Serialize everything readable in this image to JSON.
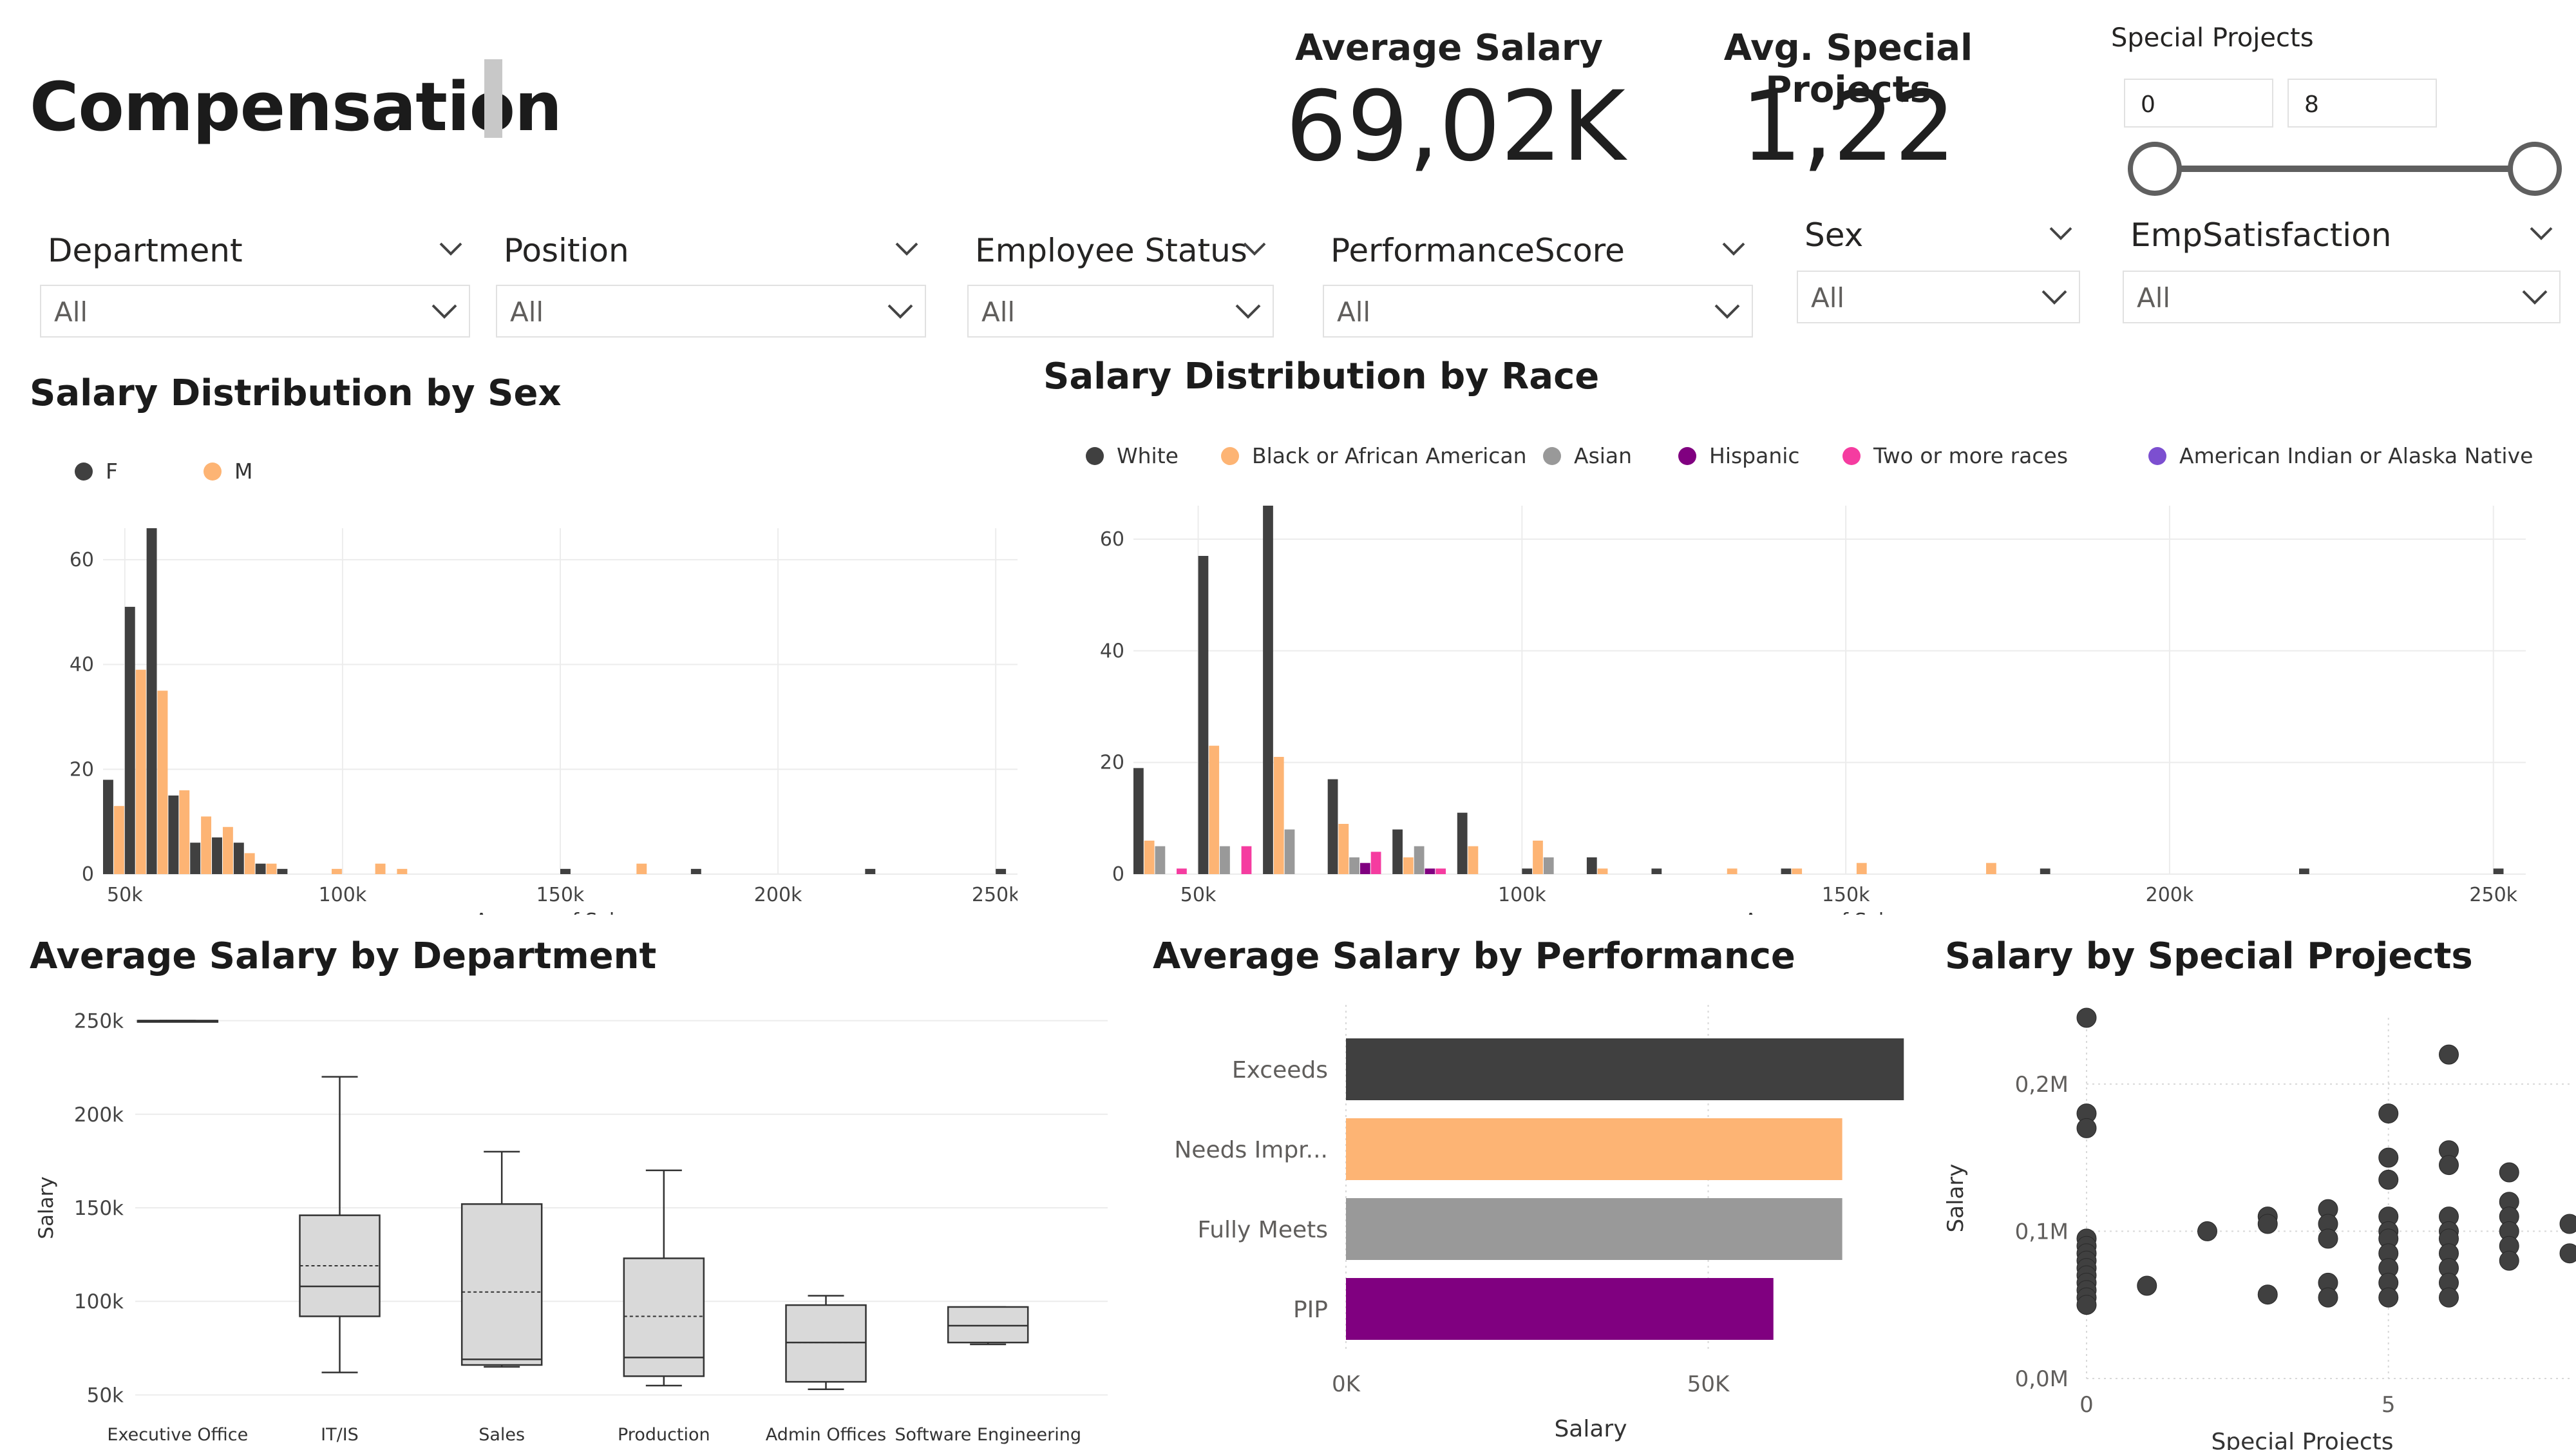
{
  "page": {
    "title": "Compensation"
  },
  "kpis": [
    {
      "label": "Average Salary",
      "value": "69,02K"
    },
    {
      "label": "Avg. Special Projects",
      "value": "1,22"
    }
  ],
  "special_projects_slicer": {
    "label": "Special Projects",
    "min": "0",
    "max": "8",
    "range_fraction": [
      0,
      1
    ]
  },
  "slicers": [
    {
      "title": "Department",
      "value": "All"
    },
    {
      "title": "Position",
      "value": "All"
    },
    {
      "title": "Employee Status",
      "value": "All"
    },
    {
      "title": "PerformanceScore",
      "value": "All"
    },
    {
      "title": "Sex",
      "value": "All"
    },
    {
      "title": "EmpSatisfaction",
      "value": "All"
    }
  ],
  "colors": {
    "white_f": "#404040",
    "black_m": "#FDB474",
    "asian": "#999999",
    "hispanic": "#800080",
    "two_or_more": "#F53CA0",
    "amer_indian": "#7C4FD0",
    "box_fill": "#d9d9d9",
    "grid": "#ececec"
  },
  "visuals": {
    "sex_hist": {
      "title": "Salary Distribution by Sex",
      "xlabel": "Average of Salary"
    },
    "race_hist": {
      "title": "Salary Distribution by Race",
      "xlabel": "Average of Salary"
    },
    "dept_box": {
      "title": "Average Salary by Department",
      "ylabel": "Salary"
    },
    "perf_bar": {
      "title": "Average Salary by Performance",
      "xlabel": "Salary"
    },
    "sp_scatter": {
      "title": "Salary by Special Projects",
      "xlabel": "Special Projects",
      "ylabel": "Salary"
    }
  },
  "chart_data": [
    {
      "type": "bar",
      "title": "Salary Distribution by Sex",
      "xlabel": "Average of Salary",
      "ylabel": "",
      "xlim": [
        45000,
        255000
      ],
      "ylim": [
        0,
        66
      ],
      "bin_width": 5000,
      "x_ticks": [
        50000,
        100000,
        150000,
        200000,
        250000
      ],
      "x_tick_labels": [
        "50k",
        "100k",
        "150k",
        "200k",
        "250k"
      ],
      "y_ticks": [
        0,
        20,
        40,
        60
      ],
      "legend": "top-left",
      "grid": true,
      "bin_starts": [
        45000,
        50000,
        55000,
        60000,
        65000,
        70000,
        75000,
        80000,
        85000,
        90000,
        95000,
        100000,
        105000,
        110000,
        115000,
        120000,
        125000,
        130000,
        135000,
        140000,
        145000,
        150000,
        155000,
        160000,
        165000,
        170000,
        175000,
        180000,
        185000,
        190000,
        195000,
        200000,
        205000,
        210000,
        215000,
        220000,
        225000,
        230000,
        235000,
        240000,
        245000,
        250000
      ],
      "series": [
        {
          "name": "F",
          "color": "#404040",
          "values": [
            18,
            51,
            66,
            15,
            6,
            7,
            6,
            2,
            1,
            0,
            0,
            0,
            0,
            0,
            0,
            0,
            0,
            0,
            0,
            0,
            0,
            1,
            0,
            0,
            0,
            0,
            0,
            1,
            0,
            0,
            0,
            0,
            0,
            0,
            0,
            1,
            0,
            0,
            0,
            0,
            0,
            1
          ]
        },
        {
          "name": "M",
          "color": "#FDB474",
          "values": [
            13,
            39,
            35,
            16,
            11,
            9,
            4,
            2,
            0,
            0,
            1,
            0,
            2,
            1,
            0,
            0,
            0,
            0,
            0,
            0,
            0,
            0,
            0,
            0,
            2,
            0,
            0,
            0,
            0,
            0,
            0,
            0,
            0,
            0,
            0,
            0,
            0,
            0,
            0,
            0,
            0,
            0
          ]
        }
      ]
    },
    {
      "type": "bar",
      "title": "Salary Distribution by Race",
      "xlabel": "Average of Salary",
      "ylabel": "",
      "xlim": [
        40000,
        255000
      ],
      "ylim": [
        0,
        66
      ],
      "bin_width": 10000,
      "x_ticks": [
        50000,
        100000,
        150000,
        200000,
        250000
      ],
      "x_tick_labels": [
        "50k",
        "100k",
        "150k",
        "200k",
        "250k"
      ],
      "y_ticks": [
        0,
        20,
        40,
        60
      ],
      "legend": "top",
      "grid": true,
      "bin_starts": [
        40000,
        50000,
        60000,
        70000,
        80000,
        90000,
        100000,
        110000,
        120000,
        130000,
        140000,
        150000,
        160000,
        170000,
        180000,
        190000,
        200000,
        210000,
        220000,
        230000,
        240000,
        250000
      ],
      "series": [
        {
          "name": "White",
          "color": "#404040",
          "values": [
            19,
            57,
            66,
            17,
            8,
            11,
            1,
            3,
            1,
            0,
            1,
            0,
            0,
            0,
            1,
            0,
            0,
            0,
            1,
            0,
            0,
            1
          ]
        },
        {
          "name": "Black or African American",
          "color": "#FDB474",
          "values": [
            6,
            23,
            21,
            9,
            3,
            5,
            6,
            1,
            0,
            1,
            1,
            2,
            0,
            2,
            0,
            0,
            0,
            0,
            0,
            0,
            0,
            0
          ]
        },
        {
          "name": "Asian",
          "color": "#999999",
          "values": [
            5,
            5,
            8,
            3,
            5,
            0,
            3,
            0,
            0,
            0,
            0,
            0,
            0,
            0,
            0,
            0,
            0,
            0,
            0,
            0,
            0,
            0
          ]
        },
        {
          "name": "Hispanic",
          "color": "#800080",
          "values": [
            0,
            0,
            0,
            2,
            1,
            0,
            0,
            0,
            0,
            0,
            0,
            0,
            0,
            0,
            0,
            0,
            0,
            0,
            0,
            0,
            0,
            0
          ]
        },
        {
          "name": "Two or more races",
          "color": "#F53CA0",
          "values": [
            1,
            5,
            0,
            4,
            1,
            0,
            0,
            0,
            0,
            0,
            0,
            0,
            0,
            0,
            0,
            0,
            0,
            0,
            0,
            0,
            0,
            0
          ]
        },
        {
          "name": "American Indian or Alaska Native",
          "color": "#7C4FD0",
          "values": [
            0,
            0,
            0,
            0,
            0,
            0,
            0,
            0,
            0,
            0,
            0,
            0,
            0,
            0,
            0,
            0,
            0,
            0,
            0,
            0,
            0,
            0
          ]
        }
      ]
    },
    {
      "type": "box",
      "title": "Average Salary by Department",
      "ylabel": "Salary",
      "ylim": [
        45000,
        255000
      ],
      "y_ticks": [
        50000,
        100000,
        150000,
        200000,
        250000
      ],
      "y_tick_labels": [
        "50k",
        "100k",
        "150k",
        "200k",
        "250k"
      ],
      "grid": true,
      "categories": [
        "Executive Office",
        "IT/IS",
        "Sales",
        "Production",
        "Admin Offices",
        "Software Engineering"
      ],
      "boxes": [
        {
          "min": 250000,
          "q1": 250000,
          "median": 250000,
          "mean": 250000,
          "q3": 250000,
          "max": 250000
        },
        {
          "min": 62000,
          "q1": 92000,
          "median": 108000,
          "mean": 119000,
          "q3": 146000,
          "max": 220000
        },
        {
          "min": 65000,
          "q1": 66000,
          "median": 69000,
          "mean": 105000,
          "q3": 152000,
          "max": 180000
        },
        {
          "min": 55000,
          "q1": 60000,
          "median": 70000,
          "mean": 92000,
          "q3": 123000,
          "max": 170000
        },
        {
          "min": 53000,
          "q1": 57000,
          "median": 78000,
          "mean": 78000,
          "q3": 98000,
          "max": 103000
        },
        {
          "min": 77000,
          "q1": 78000,
          "median": 87000,
          "mean": 87000,
          "q3": 97000,
          "max": 97000
        }
      ]
    },
    {
      "type": "bar",
      "orientation": "horizontal",
      "title": "Average Salary by Performance",
      "xlabel": "Salary",
      "xlim": [
        0,
        80000
      ],
      "x_ticks": [
        0,
        50000
      ],
      "x_tick_labels": [
        "0K",
        "50K"
      ],
      "grid": true,
      "categories": [
        "Exceeds",
        "Needs Impr...",
        "Fully Meets",
        "PIP"
      ],
      "values": [
        77000,
        68500,
        68500,
        59000
      ],
      "colors": [
        "#404040",
        "#FDB474",
        "#999999",
        "#800080"
      ]
    },
    {
      "type": "scatter",
      "title": "Salary by Special Projects",
      "xlabel": "Special Projects",
      "ylabel": "Salary",
      "xlim": [
        0,
        8
      ],
      "ylim": [
        0,
        245000
      ],
      "x_ticks": [
        0,
        5
      ],
      "y_ticks": [
        0,
        100000,
        200000
      ],
      "y_tick_labels": [
        "0,0M",
        "0,1M",
        "0,2M"
      ],
      "grid": true,
      "color": "#404040",
      "points": [
        [
          0,
          245000
        ],
        [
          0,
          180000
        ],
        [
          0,
          170000
        ],
        [
          0,
          95000
        ],
        [
          0,
          90000
        ],
        [
          0,
          85000
        ],
        [
          0,
          80000
        ],
        [
          0,
          75000
        ],
        [
          0,
          70000
        ],
        [
          0,
          65000
        ],
        [
          0,
          60000
        ],
        [
          0,
          55000
        ],
        [
          0,
          50000
        ],
        [
          1,
          63000
        ],
        [
          2,
          100000
        ],
        [
          3,
          110000
        ],
        [
          3,
          105000
        ],
        [
          3,
          57000
        ],
        [
          4,
          115000
        ],
        [
          4,
          105000
        ],
        [
          4,
          95000
        ],
        [
          4,
          65000
        ],
        [
          4,
          55000
        ],
        [
          5,
          180000
        ],
        [
          5,
          150000
        ],
        [
          5,
          135000
        ],
        [
          5,
          110000
        ],
        [
          5,
          100000
        ],
        [
          5,
          95000
        ],
        [
          5,
          85000
        ],
        [
          5,
          75000
        ],
        [
          5,
          65000
        ],
        [
          5,
          55000
        ],
        [
          6,
          220000
        ],
        [
          6,
          155000
        ],
        [
          6,
          145000
        ],
        [
          6,
          110000
        ],
        [
          6,
          100000
        ],
        [
          6,
          95000
        ],
        [
          6,
          85000
        ],
        [
          6,
          75000
        ],
        [
          6,
          65000
        ],
        [
          6,
          55000
        ],
        [
          7,
          140000
        ],
        [
          7,
          120000
        ],
        [
          7,
          110000
        ],
        [
          7,
          100000
        ],
        [
          7,
          90000
        ],
        [
          7,
          80000
        ],
        [
          8,
          105000
        ],
        [
          8,
          85000
        ]
      ]
    }
  ]
}
